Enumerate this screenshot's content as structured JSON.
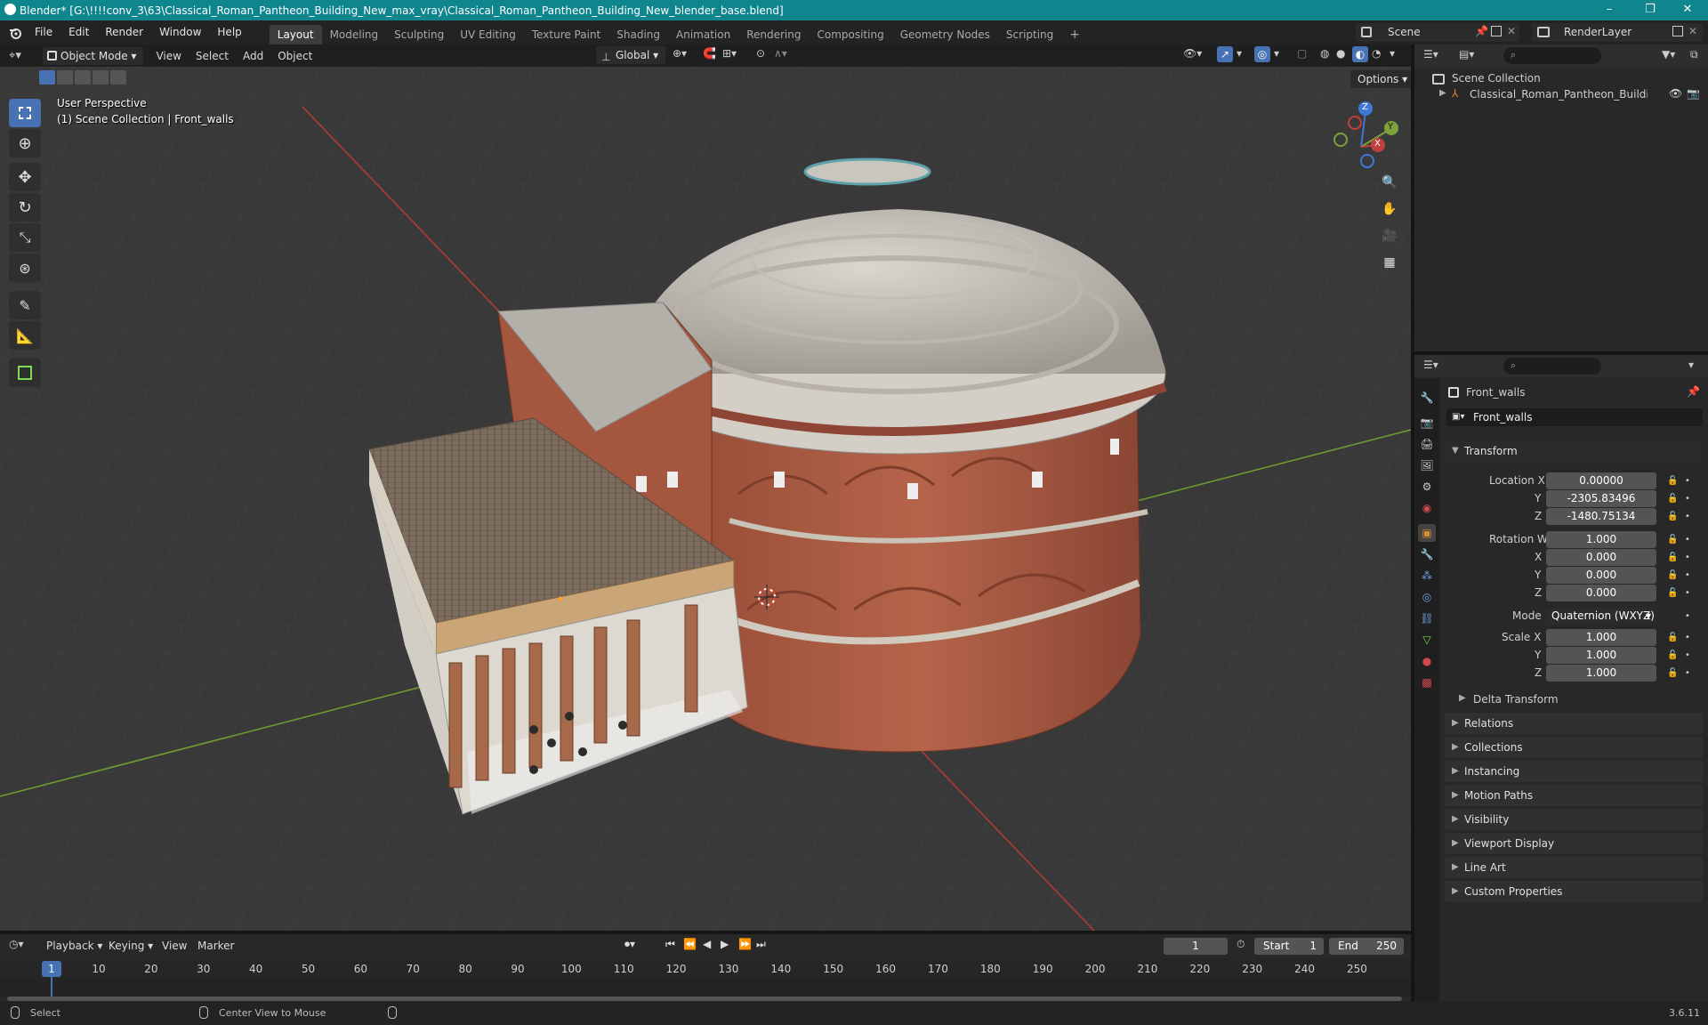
{
  "window": {
    "title": "Blender* [G:\\!!!!conv_3\\63\\Classical_Roman_Pantheon_Building_New_max_vray\\Classical_Roman_Pantheon_Building_New_blender_base.blend]",
    "minimize": "–",
    "maximize": "❐",
    "close": "✕"
  },
  "menu": [
    "File",
    "Edit",
    "Render",
    "Window",
    "Help"
  ],
  "workspaces": [
    "Layout",
    "Modeling",
    "Sculpting",
    "UV Editing",
    "Texture Paint",
    "Shading",
    "Animation",
    "Rendering",
    "Compositing",
    "Geometry Nodes",
    "Scripting"
  ],
  "workspace_add": "+",
  "scene": {
    "name": "Scene",
    "render_layer": "RenderLayer"
  },
  "viewport_header": {
    "mode": "Object Mode",
    "menus": [
      "View",
      "Select",
      "Add",
      "Object"
    ],
    "transform_orientation": "Global",
    "options": "Options"
  },
  "viewport": {
    "perspective": "User Perspective",
    "collection_info": "(1) Scene Collection | Front_walls",
    "gizmo": {
      "z": "Z",
      "y": "Y",
      "x": "X"
    }
  },
  "outliner": {
    "root": "Scene Collection",
    "items": [
      {
        "label": "Classical_Roman_Pantheon_Building_Ne"
      }
    ]
  },
  "properties": {
    "object_name": "Front_walls",
    "data_name": "Front_walls",
    "transform": {
      "title": "Transform",
      "location_label": "Location X",
      "location": {
        "x": "0.00000",
        "y": "-2305.83496",
        "z": "-1480.75134"
      },
      "rotation_label": "Rotation W",
      "rotation": {
        "w": "1.000",
        "x": "0.000",
        "y": "0.000",
        "z": "0.000"
      },
      "mode_label": "Mode",
      "mode": "Quaternion (WXYZ)",
      "scale_label": "Scale X",
      "scale": {
        "x": "1.000",
        "y": "1.000",
        "z": "1.000"
      },
      "axis_labels": {
        "x": "X",
        "y": "Y",
        "z": "Z"
      },
      "delta": "Delta Transform"
    },
    "panels": [
      "Relations",
      "Collections",
      "Instancing",
      "Motion Paths",
      "Visibility",
      "Viewport Display",
      "Line Art",
      "Custom Properties"
    ]
  },
  "timeline": {
    "menus": [
      "Playback",
      "Keying",
      "View",
      "Marker"
    ],
    "current_frame": "1",
    "start_label": "Start",
    "start": "1",
    "end_label": "End",
    "end": "250",
    "ticks": [
      "1",
      "10",
      "20",
      "30",
      "40",
      "50",
      "60",
      "70",
      "80",
      "90",
      "100",
      "110",
      "120",
      "130",
      "140",
      "150",
      "160",
      "170",
      "180",
      "190",
      "200",
      "210",
      "220",
      "230",
      "240",
      "250"
    ]
  },
  "statusbar": {
    "select": "Select",
    "center": "Center View to Mouse",
    "version": "3.6.11"
  },
  "colors": {
    "titlebar": "#0f858e",
    "accent": "#4772b3",
    "x_axis": "#c2403c",
    "y_axis": "#7ba33a",
    "z_axis": "#3f78d6"
  }
}
